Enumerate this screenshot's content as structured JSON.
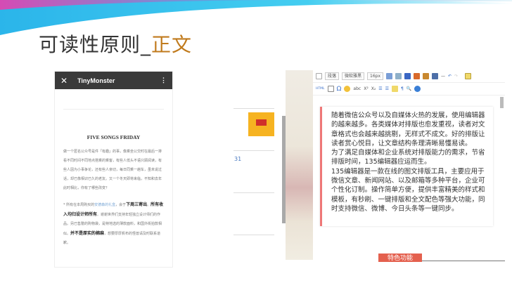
{
  "slide": {
    "title_main": "可读性原则_",
    "title_accent": "正文",
    "accent_color": "#c07a1c"
  },
  "phone": {
    "close_icon": "close-icon",
    "app_name": "TinyMonster",
    "menu_icon": "more-vertical-icon",
    "heading": "FIVE SONGS FRIDAY",
    "para1": "做一个匿名公众号是件「有趣」的事，像乘坐公交时在最后一排看不同时间不同地点搭乘的乘客，有些人低头不语只顾阅读，有些人因为小事争论，还有些人亲切，每日同乘一趟车，虽未说过话，却已像相识已久的老友。又一个冬天即将来临，不知和去年此时相比，你有了哪些改变？",
    "para2_a": "* 所有在本周购买的",
    "para2_link": "安德森的礼盒",
    "para2_b": "，会于",
    "para2_bold1": "下周三寄出",
    "para2_c": "。",
    "para2_bold2": "所有收入均归设计师所有",
    "para2_d": "。谢谢世界们支持年轻独立设计师们的作品。另已售罄的购物袋，是特地选的薄款面料，和国外街拍款相似。",
    "para2_bold3": "并不是厚实的棉麻",
    "para2_e": "，想要厚厚帆布的怪兽请及时联系道歉。"
  },
  "middle": {
    "badge_text": "31"
  },
  "editor": {
    "toolbar": {
      "paragraph": "段落",
      "font": "微软雅黑",
      "size": "16px",
      "html": "HTML",
      "omega": "Ω"
    },
    "body": "随着微信公众号以及自媒体火热的发展，使用编辑器的越来越多。各类媒体对排版也愈发重视，读者对文章格式也会越来越挑剔，无样式不成文。好的排版让读者赏心悦目，让文章结构条理清晰易懂易读。\n为了满足自媒体和企业系统对排版能力的需求，节省排版时间，135编辑器应运而生。\n135编辑器是一款在线的图文排版工具，主要应用于微信文章、新闻网站、以及邮箱等多种平台，企业可个性化订制。操作简单方便，提供丰富精美的样式和模板，有秒刷、一键排版和全文配色等强大功能，同时支持微信、微博、今日头条等一键同步。",
    "feature_button": "特色功能",
    "feature_color": "#e4604e"
  }
}
